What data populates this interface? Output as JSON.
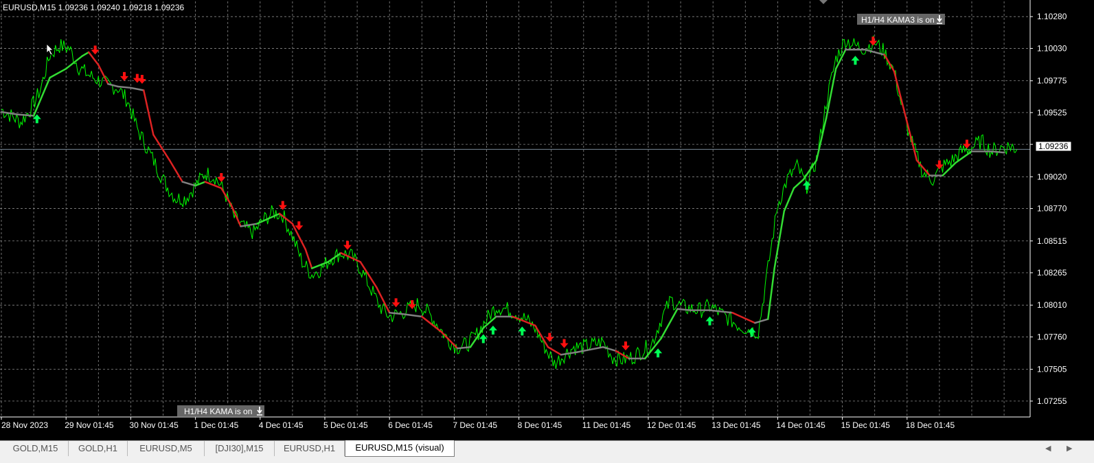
{
  "window": {
    "header": "EURUSD,M15  1.09236 1.09240 1.09218 1.09236",
    "current_price_label": "1.09236",
    "current_price": 1.09236
  },
  "chart_data": {
    "type": "line",
    "ylim": [
      1.0713,
      1.104
    ],
    "x_tick_labels": [
      "28 Nov 2023",
      "29 Nov 01:45",
      "30 Nov 01:45",
      "1 Dec 01:45",
      "4 Dec 01:45",
      "5 Dec 01:45",
      "6 Dec 01:45",
      "7 Dec 01:45",
      "8 Dec 01:45",
      "11 Dec 01:45",
      "12 Dec 01:45",
      "13 Dec 01:45",
      "14 Dec 01:45",
      "15 Dec 01:45",
      "18 Dec 01:45"
    ],
    "y_ticks": [
      1.1028,
      1.1003,
      1.09775,
      1.09525,
      1.09275,
      1.0902,
      1.0877,
      1.08515,
      1.08265,
      1.0801,
      1.0776,
      1.07505,
      1.07255
    ],
    "y_tick_labels": [
      "1.10280",
      "1.10030",
      "1.09775",
      "1.09525",
      "1.09275",
      "1.09020",
      "1.08770",
      "1.08515",
      "1.08265",
      "1.08010",
      "1.07760",
      "1.07505",
      "1.07255"
    ],
    "price": [
      [
        0,
        1.0955
      ],
      [
        0.3,
        1.095
      ],
      [
        0.6,
        1.0945
      ],
      [
        0.9,
        1.0955
      ],
      [
        1.2,
        1.097
      ],
      [
        1.5,
        1.0998
      ],
      [
        1.8,
        1.1005
      ],
      [
        2.1,
        1.1003
      ],
      [
        2.4,
        1.0988
      ],
      [
        2.7,
        1.0982
      ],
      [
        3.0,
        1.0978
      ],
      [
        3.3,
        1.0974
      ],
      [
        3.6,
        1.0972
      ],
      [
        3.9,
        1.0962
      ],
      [
        4.2,
        1.094
      ],
      [
        4.5,
        1.0925
      ],
      [
        4.8,
        1.091
      ],
      [
        5.1,
        1.0895
      ],
      [
        5.4,
        1.0885
      ],
      [
        5.7,
        1.0885
      ],
      [
        6.0,
        1.0895
      ],
      [
        6.3,
        1.0905
      ],
      [
        6.6,
        1.0902
      ],
      [
        6.9,
        1.089
      ],
      [
        7.2,
        1.087
      ],
      [
        7.5,
        1.0862
      ],
      [
        7.8,
        1.0858
      ],
      [
        8.1,
        1.0868
      ],
      [
        8.4,
        1.0874
      ],
      [
        8.7,
        1.0872
      ],
      [
        9.0,
        1.0855
      ],
      [
        9.3,
        1.0835
      ],
      [
        9.6,
        1.0825
      ],
      [
        9.9,
        1.083
      ],
      [
        10.2,
        1.0838
      ],
      [
        10.5,
        1.0842
      ],
      [
        10.8,
        1.084
      ],
      [
        11.1,
        1.083
      ],
      [
        11.4,
        1.0815
      ],
      [
        11.7,
        1.08
      ],
      [
        12.0,
        1.0792
      ],
      [
        12.3,
        1.0794
      ],
      [
        12.6,
        1.0798
      ],
      [
        12.9,
        1.0802
      ],
      [
        13.2,
        1.0795
      ],
      [
        13.5,
        1.0785
      ],
      [
        13.8,
        1.0774
      ],
      [
        14.1,
        1.0768
      ],
      [
        14.4,
        1.077
      ],
      [
        14.7,
        1.0778
      ],
      [
        15.0,
        1.079
      ],
      [
        15.3,
        1.08
      ],
      [
        15.6,
        1.0798
      ],
      [
        15.9,
        1.0795
      ],
      [
        16.2,
        1.079
      ],
      [
        16.5,
        1.0783
      ],
      [
        16.8,
        1.0768
      ],
      [
        17.1,
        1.0755
      ],
      [
        17.4,
        1.0762
      ],
      [
        17.7,
        1.0768
      ],
      [
        18.0,
        1.0768
      ],
      [
        18.3,
        1.077
      ],
      [
        18.6,
        1.0772
      ],
      [
        18.9,
        1.076
      ],
      [
        19.2,
        1.0758
      ],
      [
        19.5,
        1.076
      ],
      [
        19.8,
        1.0765
      ],
      [
        20.1,
        1.077
      ],
      [
        20.4,
        1.079
      ],
      [
        20.7,
        1.0805
      ],
      [
        21.0,
        1.08
      ],
      [
        21.3,
        1.0798
      ],
      [
        21.6,
        1.0797
      ],
      [
        21.9,
        1.08
      ],
      [
        22.2,
        1.0795
      ],
      [
        22.5,
        1.079
      ],
      [
        22.8,
        1.0785
      ],
      [
        23.1,
        1.0782
      ],
      [
        23.4,
        1.078
      ],
      [
        23.7,
        1.083
      ],
      [
        24.0,
        1.088
      ],
      [
        24.3,
        1.09
      ],
      [
        24.6,
        1.091
      ],
      [
        24.9,
        1.0895
      ],
      [
        25.2,
        1.0915
      ],
      [
        25.5,
        1.096
      ],
      [
        25.8,
        1.0995
      ],
      [
        26.1,
        1.101
      ],
      [
        26.4,
        1.1005
      ],
      [
        26.7,
        1.1003
      ],
      [
        27.0,
        1.1008
      ],
      [
        27.3,
        1.1
      ],
      [
        27.6,
        1.0985
      ],
      [
        27.9,
        1.095
      ],
      [
        28.2,
        1.0925
      ],
      [
        28.5,
        1.0905
      ],
      [
        28.8,
        1.09
      ],
      [
        29.1,
        1.091
      ],
      [
        29.4,
        1.0915
      ],
      [
        29.7,
        1.0922
      ],
      [
        30.0,
        1.0925
      ],
      [
        30.3,
        1.093
      ],
      [
        30.6,
        1.0922
      ],
      [
        30.9,
        1.0925
      ],
      [
        31.2,
        1.0926
      ],
      [
        31.4,
        1.09236
      ]
    ],
    "kama_line": [
      [
        0,
        1.0953
      ],
      [
        0.5,
        1.0951
      ],
      [
        1.0,
        1.095
      ],
      [
        1.5,
        1.098
      ],
      [
        2.0,
        1.0987
      ],
      [
        2.5,
        1.0997
      ],
      [
        2.7,
        1.1
      ],
      [
        3.0,
        1.099
      ],
      [
        3.3,
        1.0975
      ],
      [
        3.6,
        1.0973
      ],
      [
        4.0,
        1.0972
      ],
      [
        4.4,
        1.097
      ],
      [
        4.7,
        1.0935
      ],
      [
        5.2,
        1.0915
      ],
      [
        5.6,
        1.0898
      ],
      [
        6.0,
        1.0895
      ],
      [
        6.3,
        1.0898
      ],
      [
        6.8,
        1.0893
      ],
      [
        7.1,
        1.088
      ],
      [
        7.4,
        1.0863
      ],
      [
        7.9,
        1.0865
      ],
      [
        8.6,
        1.0873
      ],
      [
        9.0,
        1.0865
      ],
      [
        9.4,
        1.0845
      ],
      [
        9.6,
        1.083
      ],
      [
        10.1,
        1.0835
      ],
      [
        10.5,
        1.0842
      ],
      [
        11.1,
        1.0835
      ],
      [
        11.6,
        1.0815
      ],
      [
        12.0,
        1.0795
      ],
      [
        12.4,
        1.0794
      ],
      [
        13.0,
        1.0792
      ],
      [
        13.6,
        1.078
      ],
      [
        14.1,
        1.0767
      ],
      [
        14.5,
        1.0768
      ],
      [
        14.9,
        1.0783
      ],
      [
        15.3,
        1.0792
      ],
      [
        15.8,
        1.0792
      ],
      [
        16.5,
        1.0785
      ],
      [
        16.9,
        1.0768
      ],
      [
        17.3,
        1.0762
      ],
      [
        17.8,
        1.0764
      ],
      [
        18.2,
        1.0766
      ],
      [
        18.6,
        1.0768
      ],
      [
        19.0,
        1.0765
      ],
      [
        19.4,
        1.0759
      ],
      [
        19.9,
        1.0759
      ],
      [
        20.4,
        1.0775
      ],
      [
        20.9,
        1.0798
      ],
      [
        21.3,
        1.0797
      ],
      [
        21.9,
        1.0797
      ],
      [
        22.6,
        1.0795
      ],
      [
        23.3,
        1.0787
      ],
      [
        23.7,
        1.079
      ],
      [
        23.9,
        1.083
      ],
      [
        24.2,
        1.0875
      ],
      [
        24.5,
        1.0893
      ],
      [
        24.8,
        1.09
      ],
      [
        25.2,
        1.0915
      ],
      [
        25.5,
        1.0948
      ],
      [
        25.8,
        1.0987
      ],
      [
        26.1,
        1.1002
      ],
      [
        26.7,
        1.1002
      ],
      [
        27.3,
        1.0998
      ],
      [
        27.6,
        1.0985
      ],
      [
        27.9,
        1.0955
      ],
      [
        28.3,
        1.0915
      ],
      [
        28.7,
        1.0903
      ],
      [
        29.1,
        1.0903
      ],
      [
        29.5,
        1.0913
      ],
      [
        30.0,
        1.0922
      ],
      [
        30.6,
        1.0922
      ],
      [
        31.0,
        1.0921
      ]
    ],
    "signals": [
      {
        "t": 1.1,
        "dir": "up"
      },
      {
        "t": 2.9,
        "dir": "down"
      },
      {
        "t": 3.8,
        "dir": "down"
      },
      {
        "t": 4.2,
        "dir": "down"
      },
      {
        "t": 4.35,
        "dir": "down"
      },
      {
        "t": 6.8,
        "dir": "down"
      },
      {
        "t": 8.7,
        "dir": "down"
      },
      {
        "t": 9.2,
        "dir": "down"
      },
      {
        "t": 10.7,
        "dir": "down"
      },
      {
        "t": 12.2,
        "dir": "down"
      },
      {
        "t": 12.7,
        "dir": "down"
      },
      {
        "t": 14.9,
        "dir": "up"
      },
      {
        "t": 15.2,
        "dir": "up"
      },
      {
        "t": 16.1,
        "dir": "up"
      },
      {
        "t": 16.95,
        "dir": "down"
      },
      {
        "t": 17.4,
        "dir": "down"
      },
      {
        "t": 19.3,
        "dir": "down"
      },
      {
        "t": 20.3,
        "dir": "up"
      },
      {
        "t": 21.9,
        "dir": "up"
      },
      {
        "t": 23.2,
        "dir": "up"
      },
      {
        "t": 24.9,
        "dir": "up"
      },
      {
        "t": 26.4,
        "dir": "up"
      },
      {
        "t": 26.95,
        "dir": "down"
      },
      {
        "t": 29.0,
        "dir": "down"
      },
      {
        "t": 29.85,
        "dir": "down"
      }
    ],
    "colors": {
      "background": "#000000",
      "price": "#00ff00",
      "kama_up": "#33dd33",
      "kama_down": "#dd2222",
      "kama_flat": "#808080",
      "arrow_up": "#00ff55",
      "arrow_down": "#ff1010",
      "grid": "#8a8a8a",
      "text": "#ffffff"
    },
    "grid": true
  },
  "badges": {
    "top": "H1/H4 KAMA3 is on",
    "bottom": "H1/H4 KAMA is on"
  },
  "tabs": [
    {
      "label": "GOLD,M15",
      "active": false
    },
    {
      "label": "GOLD,H1",
      "active": false
    },
    {
      "label": "EURUSD,M5",
      "active": false
    },
    {
      "label": "[DJI30],M15",
      "active": false
    },
    {
      "label": "EURUSD,H1",
      "active": false
    },
    {
      "label": "EURUSD,M15 (visual)",
      "active": true
    }
  ],
  "icons": {
    "tab_scroll_left": "chevron-left-icon",
    "tab_scroll_right": "chevron-right-icon",
    "badge_toggle": "download-arrow-icon",
    "cursor": "mouse-pointer-icon"
  }
}
